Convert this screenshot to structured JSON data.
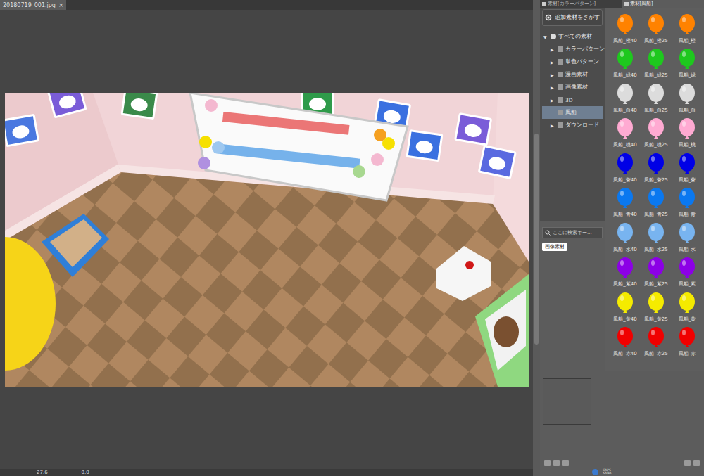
{
  "document_tabs": [
    {
      "label": "20180719_001.jpg",
      "close": "×",
      "selected": true
    }
  ],
  "canvas_status": {
    "zoom": "27.6",
    "angle": "0.0"
  },
  "panel_tabs": [
    {
      "label": "素材[カラーパターン]",
      "selected": false
    },
    {
      "label": "素材[風船]",
      "selected": true
    }
  ],
  "find_button": {
    "label": "追加素材をさがす"
  },
  "tree_glyphs": {
    "expanded": "▼",
    "collapsed": "▶"
  },
  "tree": [
    {
      "label": "すべての素材",
      "depth": 0,
      "has_children": true,
      "expanded": true,
      "selected": false
    },
    {
      "label": "カラーパターン",
      "depth": 1,
      "has_children": true,
      "expanded": false,
      "selected": false
    },
    {
      "label": "単色パターン",
      "depth": 1,
      "has_children": true,
      "expanded": false,
      "selected": false
    },
    {
      "label": "漫画素材",
      "depth": 1,
      "has_children": true,
      "expanded": false,
      "selected": false
    },
    {
      "label": "画像素材",
      "depth": 1,
      "has_children": true,
      "expanded": false,
      "selected": false
    },
    {
      "label": "3D",
      "depth": 1,
      "has_children": true,
      "expanded": false,
      "selected": false
    },
    {
      "label": "風船",
      "depth": 1,
      "has_children": false,
      "expanded": false,
      "selected": true
    },
    {
      "label": "ダウンロード",
      "depth": 1,
      "has_children": true,
      "expanded": false,
      "selected": false
    }
  ],
  "search": {
    "placeholder": "ここに検索キー..."
  },
  "tags": [
    {
      "label": "画像素材"
    }
  ],
  "materials": [
    {
      "label": "風船_橙40",
      "color": "#ff8200"
    },
    {
      "label": "風船_橙25",
      "color": "#ff8200"
    },
    {
      "label": "風船_橙",
      "color": "#ff8200"
    },
    {
      "label": "風船_緑40",
      "color": "#1ec81e"
    },
    {
      "label": "風船_緑25",
      "color": "#1ec81e"
    },
    {
      "label": "風船_緑",
      "color": "#1ec81e"
    },
    {
      "label": "風船_白40",
      "color": "#dcdcdc"
    },
    {
      "label": "風船_白25",
      "color": "#dcdcdc"
    },
    {
      "label": "風船_白",
      "color": "#dcdcdc"
    },
    {
      "label": "風船_桃40",
      "color": "#ffaad2"
    },
    {
      "label": "風船_桃25",
      "color": "#ffaad2"
    },
    {
      "label": "風船_桃",
      "color": "#ffaad2"
    },
    {
      "label": "風船_蒼40",
      "color": "#0000e6"
    },
    {
      "label": "風船_蒼25",
      "color": "#0000e6"
    },
    {
      "label": "風船_蒼",
      "color": "#0000e6"
    },
    {
      "label": "風船_青40",
      "color": "#0a78f0"
    },
    {
      "label": "風船_青25",
      "color": "#0a78f0"
    },
    {
      "label": "風船_青",
      "color": "#0a78f0"
    },
    {
      "label": "風船_水40",
      "color": "#78b4f0"
    },
    {
      "label": "風船_水25",
      "color": "#78b4f0"
    },
    {
      "label": "風船_水",
      "color": "#78b4f0"
    },
    {
      "label": "風船_紫40",
      "color": "#8c00e6"
    },
    {
      "label": "風船_紫25",
      "color": "#8c00e6"
    },
    {
      "label": "風船_紫",
      "color": "#8c00e6"
    },
    {
      "label": "風船_黄40",
      "color": "#f5eb00"
    },
    {
      "label": "風船_黄25",
      "color": "#f5eb00"
    },
    {
      "label": "風船_黄",
      "color": "#f5eb00"
    },
    {
      "label": "風船_赤40",
      "color": "#f00000"
    },
    {
      "label": "風船_赤25",
      "color": "#f00000"
    },
    {
      "label": "風船_赤",
      "color": "#f00000"
    }
  ],
  "status_bar": {
    "keys": [
      "CAPS",
      "KANA"
    ]
  }
}
